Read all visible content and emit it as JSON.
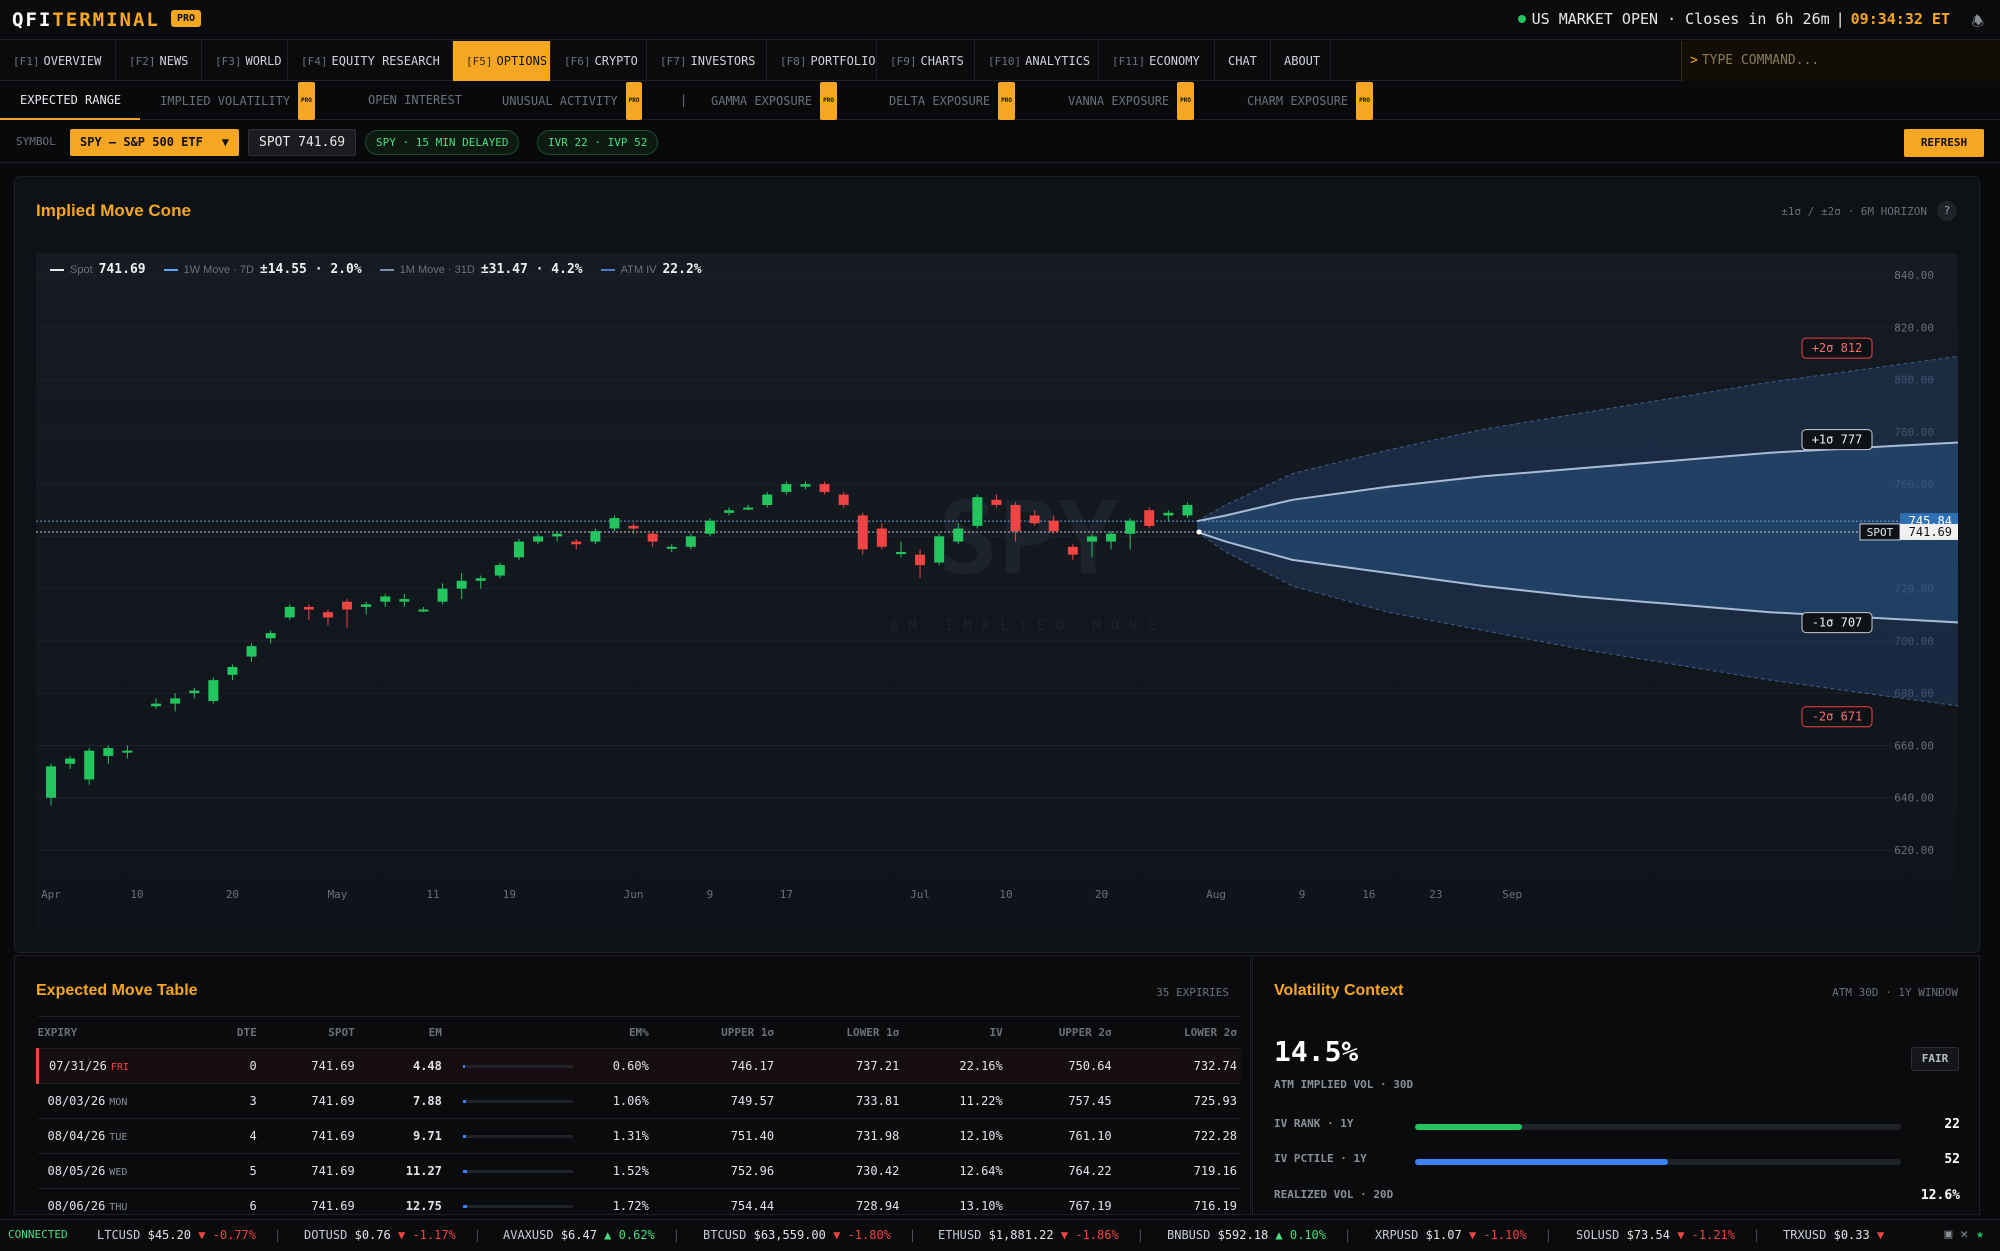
{
  "app": {
    "logo_a": "QFI",
    "logo_b": "TERMINAL",
    "pro": "PRO"
  },
  "market": {
    "status": "US MARKET OPEN · Closes in 6h 26m",
    "sep": "|",
    "time": "09:34:32 ET"
  },
  "nav": [
    {
      "key": "[F1]",
      "label": "OVERVIEW"
    },
    {
      "key": "[F2]",
      "label": "NEWS"
    },
    {
      "key": "[F3]",
      "label": "WORLD"
    },
    {
      "key": "[F4]",
      "label": "EQUITY RESEARCH"
    },
    {
      "key": "[F5]",
      "label": "OPTIONS",
      "active": true
    },
    {
      "key": "[F6]",
      "label": "CRYPTO"
    },
    {
      "key": "[F7]",
      "label": "INVESTORS"
    },
    {
      "key": "[F8]",
      "label": "PORTFOLIO"
    },
    {
      "key": "[F9]",
      "label": "CHARTS"
    },
    {
      "key": "[F10]",
      "label": "ANALYTICS"
    },
    {
      "key": "[F11]",
      "label": "ECONOMY"
    },
    {
      "key": "",
      "label": "CHAT"
    },
    {
      "key": "",
      "label": "ABOUT"
    }
  ],
  "command": {
    "prompt": ">",
    "placeholder": "TYPE COMMAND..."
  },
  "subtabs": [
    {
      "label": "EXPECTED RANGE",
      "active": true
    },
    {
      "label": "IMPLIED VOLATILITY",
      "pro": "PRO"
    },
    {
      "label": "OPEN INTEREST"
    },
    {
      "label": "UNUSUAL ACTIVITY",
      "pro": "PRO"
    },
    {
      "label": "|"
    },
    {
      "label": "GAMMA EXPOSURE",
      "pro": "PRO"
    },
    {
      "label": "DELTA EXPOSURE",
      "pro": "PRO"
    },
    {
      "label": "VANNA EXPOSURE",
      "pro": "PRO"
    },
    {
      "label": "CHARM EXPOSURE",
      "pro": "PRO"
    }
  ],
  "symbar": {
    "label": "SYMBOL",
    "symbol": "SPY — S&P 500 ETF",
    "caret": "▼",
    "spot": "SPOT 741.69",
    "delay": "SPY · 15 MIN DELAYED",
    "ivr": "IVR 22 · IVP 52",
    "refresh": "REFRESH"
  },
  "chart_panel": {
    "title": "Implied Move Cone",
    "meta": "±1σ / ±2σ · 6M HORIZON",
    "help": "?"
  },
  "legend": {
    "spot_label": "Spot",
    "spot_val": "741.69",
    "w_label": "1W Move · 7D",
    "w_val": "±14.55 · 2.0%",
    "m_label": "1M Move · 31D",
    "m_val": "±31.47 · 4.2%",
    "iv_label": "ATM IV",
    "iv_val": "22.2%"
  },
  "chart_data": {
    "type": "candlestick",
    "watermark": "SPY",
    "watermark_sub": "6M IMPLIED MOVE",
    "ylim": [
      600,
      850
    ],
    "yticks": [
      "840.00",
      "820.00",
      "800.00",
      "780.00",
      "760.00",
      "740.00",
      "720.00",
      "700.00",
      "680.00",
      "660.00",
      "640.00",
      "620.00"
    ],
    "ytick_values": [
      840,
      820,
      800,
      780,
      760,
      740,
      720,
      700,
      680,
      660,
      640,
      620
    ],
    "xticks": [
      "Apr",
      "10",
      "20",
      "May",
      "11",
      "19",
      "Jun",
      "9",
      "17",
      "Jul",
      "10",
      "20",
      "Aug",
      "9",
      "16",
      "23",
      "Sep"
    ],
    "xtick_days": [
      0,
      9,
      19,
      30,
      40,
      48,
      61,
      69,
      77,
      91,
      100,
      110,
      122,
      131,
      138,
      145,
      153
    ],
    "last_day": 120,
    "spot": 741.69,
    "level_tag": "745.84",
    "spot_tag_label": "SPOT",
    "spot_tag_value": "741.69",
    "cone_labels": [
      {
        "text": "+2σ 812",
        "v": 812,
        "kind": "p2"
      },
      {
        "text": "+1σ 777",
        "v": 777,
        "kind": "p1"
      },
      {
        "text": "-1σ 707",
        "v": 707,
        "kind": "m1"
      },
      {
        "text": "-2σ 671",
        "v": 671,
        "kind": "m2"
      }
    ],
    "cone_days": [
      120,
      123,
      130,
      140,
      150,
      160,
      170,
      180,
      190,
      200,
      210
    ],
    "cone_p1": [
      745.8,
      748,
      754,
      759,
      763,
      766,
      769,
      772,
      774,
      776,
      777
    ],
    "cone_m1": [
      741.7,
      738,
      731,
      726,
      721,
      717,
      714,
      711,
      709,
      707,
      707
    ],
    "cone_p2": [
      745.8,
      752,
      764,
      773,
      781,
      787,
      793,
      799,
      804,
      809,
      812
    ],
    "cone_m2": [
      741.7,
      734,
      721,
      711,
      704,
      697,
      691,
      685,
      680,
      675,
      671
    ],
    "candles": [
      [
        0,
        640,
        652,
        637,
        653
      ],
      [
        2,
        653,
        655,
        651,
        656
      ],
      [
        4,
        647,
        658,
        645,
        659
      ],
      [
        6,
        656,
        659,
        653,
        660
      ],
      [
        8,
        658,
        658,
        655,
        660
      ],
      [
        11,
        675,
        676,
        674,
        678
      ],
      [
        13,
        676,
        678,
        673,
        680
      ],
      [
        15,
        680,
        681,
        678,
        682
      ],
      [
        17,
        677,
        685,
        676,
        686
      ],
      [
        19,
        687,
        690,
        685,
        691
      ],
      [
        21,
        694,
        698,
        692,
        699
      ],
      [
        23,
        701,
        703,
        699,
        704
      ],
      [
        25,
        709,
        713,
        708,
        714
      ],
      [
        27,
        713,
        712,
        708,
        714
      ],
      [
        29,
        711,
        709,
        706,
        712
      ],
      [
        31,
        715,
        712,
        705,
        716
      ],
      [
        33,
        713,
        714,
        710,
        715
      ],
      [
        35,
        715,
        717,
        713,
        718
      ],
      [
        37,
        715,
        716,
        713,
        718
      ],
      [
        39,
        712,
        712,
        711,
        713
      ],
      [
        41,
        715,
        720,
        714,
        722
      ],
      [
        43,
        720,
        723,
        716,
        726
      ],
      [
        45,
        723,
        724,
        720,
        725
      ],
      [
        47,
        725,
        729,
        724,
        730
      ],
      [
        49,
        732,
        738,
        731,
        739
      ],
      [
        51,
        738,
        740,
        737,
        741
      ],
      [
        53,
        740,
        741,
        738,
        742
      ],
      [
        55,
        738,
        737,
        735,
        739
      ],
      [
        57,
        738,
        742,
        737,
        743
      ],
      [
        59,
        743,
        747,
        742,
        748
      ],
      [
        61,
        744,
        743,
        741,
        745
      ],
      [
        63,
        741,
        738,
        736,
        742
      ],
      [
        65,
        736,
        736,
        734,
        737
      ],
      [
        67,
        736,
        740,
        735,
        741
      ],
      [
        69,
        741,
        746,
        740,
        747
      ],
      [
        71,
        749,
        750,
        748,
        751
      ],
      [
        73,
        751,
        751,
        750,
        752
      ],
      [
        75,
        752,
        756,
        751,
        757
      ],
      [
        77,
        757,
        760,
        756,
        761
      ],
      [
        79,
        759,
        760,
        758,
        761
      ],
      [
        81,
        760,
        757,
        756,
        761
      ],
      [
        83,
        756,
        752,
        751,
        757
      ],
      [
        85,
        748,
        735,
        733,
        749
      ],
      [
        87,
        743,
        736,
        735,
        745
      ],
      [
        89,
        734,
        734,
        732,
        738
      ],
      [
        91,
        733,
        729,
        724,
        735
      ],
      [
        93,
        730,
        740,
        729,
        741
      ],
      [
        95,
        738,
        743,
        737,
        745
      ],
      [
        97,
        744,
        755,
        743,
        756
      ],
      [
        99,
        754,
        752,
        751,
        756
      ],
      [
        101,
        752,
        742,
        738,
        753
      ],
      [
        103,
        748,
        745,
        744,
        750
      ],
      [
        105,
        746,
        742,
        741,
        748
      ],
      [
        107,
        736,
        733,
        731,
        737
      ],
      [
        109,
        738,
        740,
        732,
        741
      ],
      [
        111,
        738,
        741,
        735,
        742
      ],
      [
        113,
        741,
        746,
        735,
        747
      ],
      [
        115,
        750,
        744,
        743,
        751
      ],
      [
        117,
        748,
        749,
        746,
        750
      ],
      [
        119,
        748,
        752,
        747,
        753
      ]
    ]
  },
  "table": {
    "title": "Expected Move Table",
    "meta": "35 EXPIRIES",
    "headers": [
      "EXPIRY",
      "DTE",
      "SPOT",
      "EM",
      "",
      "EM%",
      "UPPER 1σ",
      "LOWER 1σ",
      "IV",
      "UPPER 2σ",
      "LOWER 2σ"
    ],
    "rows": [
      {
        "date": "07/31/26",
        "day": "FRI",
        "dte": "0",
        "spot": "741.69",
        "em": "4.48",
        "bar": 0.02,
        "empct": "0.60%",
        "u1": "746.17",
        "l1": "737.21",
        "iv": "22.16%",
        "u2": "750.64",
        "l2": "732.74"
      },
      {
        "date": "08/03/26",
        "day": "MON",
        "dte": "3",
        "spot": "741.69",
        "em": "7.88",
        "bar": 0.03,
        "empct": "1.06%",
        "u1": "749.57",
        "l1": "733.81",
        "iv": "11.22%",
        "u2": "757.45",
        "l2": "725.93"
      },
      {
        "date": "08/04/26",
        "day": "TUE",
        "dte": "4",
        "spot": "741.69",
        "em": "9.71",
        "bar": 0.03,
        "empct": "1.31%",
        "u1": "751.40",
        "l1": "731.98",
        "iv": "12.10%",
        "u2": "761.10",
        "l2": "722.28"
      },
      {
        "date": "08/05/26",
        "day": "WED",
        "dte": "5",
        "spot": "741.69",
        "em": "11.27",
        "bar": 0.04,
        "empct": "1.52%",
        "u1": "752.96",
        "l1": "730.42",
        "iv": "12.64%",
        "u2": "764.22",
        "l2": "719.16"
      },
      {
        "date": "08/06/26",
        "day": "THU",
        "dte": "6",
        "spot": "741.69",
        "em": "12.75",
        "bar": 0.04,
        "empct": "1.72%",
        "u1": "754.44",
        "l1": "728.94",
        "iv": "13.10%",
        "u2": "767.19",
        "l2": "716.19"
      }
    ]
  },
  "vol": {
    "title": "Volatility Context",
    "meta": "ATM 30D · 1Y WINDOW",
    "big": "14.5%",
    "sub": "ATM IMPLIED VOL · 30D",
    "fair": "FAIR",
    "rows": [
      {
        "label": "IV RANK · 1Y",
        "value": "22",
        "pct": 0.22,
        "color": "#22c55e"
      },
      {
        "label": "IV PCTILE · 1Y",
        "value": "52",
        "pct": 0.52,
        "color": "#3b82f6"
      },
      {
        "label": "REALIZED VOL · 20D",
        "value": "12.6%"
      }
    ]
  },
  "ticker": {
    "status": "CONNECTED",
    "items": [
      {
        "sym": "LTCUSD",
        "price": "$45.20",
        "arrow": "▼",
        "chg": "-0.77%",
        "dir": "dn"
      },
      {
        "sym": "DOTUSD",
        "price": "$0.76",
        "arrow": "▼",
        "chg": "-1.17%",
        "dir": "dn"
      },
      {
        "sym": "AVAXUSD",
        "price": "$6.47",
        "arrow": "▲",
        "chg": "0.62%",
        "dir": "up"
      },
      {
        "sym": "BTCUSD",
        "price": "$63,559.00",
        "arrow": "▼",
        "chg": "-1.80%",
        "dir": "dn"
      },
      {
        "sym": "ETHUSD",
        "price": "$1,881.22",
        "arrow": "▼",
        "chg": "-1.86%",
        "dir": "dn"
      },
      {
        "sym": "BNBUSD",
        "price": "$592.18",
        "arrow": "▲",
        "chg": "0.10%",
        "dir": "up"
      },
      {
        "sym": "XRPUSD",
        "price": "$1.07",
        "arrow": "▼",
        "chg": "-1.10%",
        "dir": "dn"
      },
      {
        "sym": "SOLUSD",
        "price": "$73.54",
        "arrow": "▼",
        "chg": "-1.21%",
        "dir": "dn"
      },
      {
        "sym": "TRXUSD",
        "price": "$0.33",
        "arrow": "▼",
        "chg": "",
        "dir": "dn"
      }
    ]
  },
  "colors": {
    "accent": "#f5a623",
    "up": "#22c55e",
    "down": "#ef4444",
    "cone": "#3b82f6"
  }
}
